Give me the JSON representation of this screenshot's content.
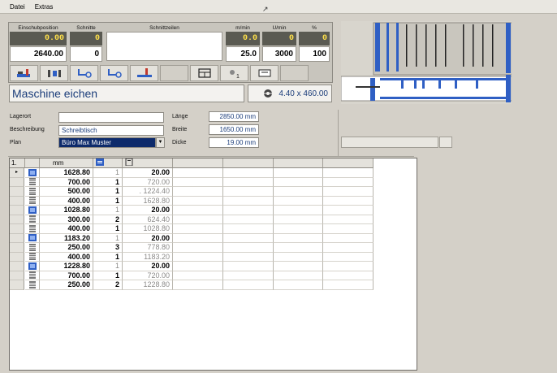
{
  "menu": {
    "items": [
      "Datei",
      "Extras"
    ]
  },
  "cursor": "ꟷ",
  "top": {
    "headers": {
      "einschub": "Einschubposition",
      "schnitte": "Schnitte",
      "schnittzeilen": "Schnittzeilen",
      "m_min": "m/min",
      "u_min": "U/min",
      "percent": "%"
    },
    "actual": {
      "einschub": "0.00",
      "schnitte": "0",
      "m_min": "0.0",
      "u_min": "0",
      "percent": "0"
    },
    "target": {
      "einschub": "2640.00",
      "schnitte": "0",
      "m_min": "25.0",
      "u_min": "3000",
      "percent": "100"
    }
  },
  "toolbar": {
    "icons": [
      "push-machine-icon",
      "clamp-icon",
      "saw-left-icon",
      "saw-right-icon",
      "lift-icon",
      "blank",
      "window-icon",
      "zero-point-icon",
      "plate-icon",
      "blank"
    ]
  },
  "status": {
    "title": "Maschine eichen",
    "blade": "4.40 x 460.00"
  },
  "form": {
    "lagerort_label": "Lagerort",
    "lagerort_value": "",
    "beschreibung_label": "Beschreibung",
    "beschreibung_value": "Schreibtisch",
    "plan_label": "Plan",
    "plan_value": "Büro Max Muster",
    "laenge_label": "Länge",
    "laenge_value": "2850.00 mm",
    "breite_label": "Breite",
    "breite_value": "1650.00 mm",
    "dicke_label": "Dicke",
    "dicke_value": "19.00 mm"
  },
  "grid": {
    "headers": {
      "idx": "1.",
      "mm": "mm"
    },
    "rows": [
      {
        "type": "blue",
        "mm": "1628.80",
        "n": "1",
        "v": "20.00",
        "dim_n": true,
        "dim_v": false
      },
      {
        "type": "stack",
        "mm": "700.00",
        "n": "1",
        "v": "720.00",
        "dim_n": false,
        "dim_v": true
      },
      {
        "type": "stack",
        "mm": "500.00",
        "n": "1",
        "v": ". 1224.40",
        "dim_n": false,
        "dim_v": true
      },
      {
        "type": "stack",
        "mm": "400.00",
        "n": "1",
        "v": "1628.80",
        "dim_n": false,
        "dim_v": true
      },
      {
        "type": "blue",
        "mm": "1028.80",
        "n": "1",
        "v": "20.00",
        "dim_n": true,
        "dim_v": false
      },
      {
        "type": "stack",
        "mm": "300.00",
        "n": "2",
        "v": "624.40",
        "dim_n": false,
        "dim_v": true
      },
      {
        "type": "stack",
        "mm": "400.00",
        "n": "1",
        "v": "1028.80",
        "dim_n": false,
        "dim_v": true
      },
      {
        "type": "blue",
        "mm": "1183.20",
        "n": "1",
        "v": "20.00",
        "dim_n": true,
        "dim_v": false
      },
      {
        "type": "stack",
        "mm": "250.00",
        "n": "3",
        "v": "778.80",
        "dim_n": false,
        "dim_v": true
      },
      {
        "type": "stack",
        "mm": "400.00",
        "n": "1",
        "v": "1183.20",
        "dim_n": false,
        "dim_v": true
      },
      {
        "type": "blue",
        "mm": "1228.80",
        "n": "1",
        "v": "20.00",
        "dim_n": true,
        "dim_v": false
      },
      {
        "type": "stack",
        "mm": "700.00",
        "n": "1",
        "v": "720.00",
        "dim_n": false,
        "dim_v": true
      },
      {
        "type": "stack",
        "mm": "250.00",
        "n": "2",
        "v": "1228.80",
        "dim_n": false,
        "dim_v": true
      }
    ]
  },
  "colors": {
    "accent_blue": "#2f5fc4",
    "display_bg": "#5a5a52",
    "display_fg": "#ffe14a",
    "title_text": "#1b3d7a"
  }
}
